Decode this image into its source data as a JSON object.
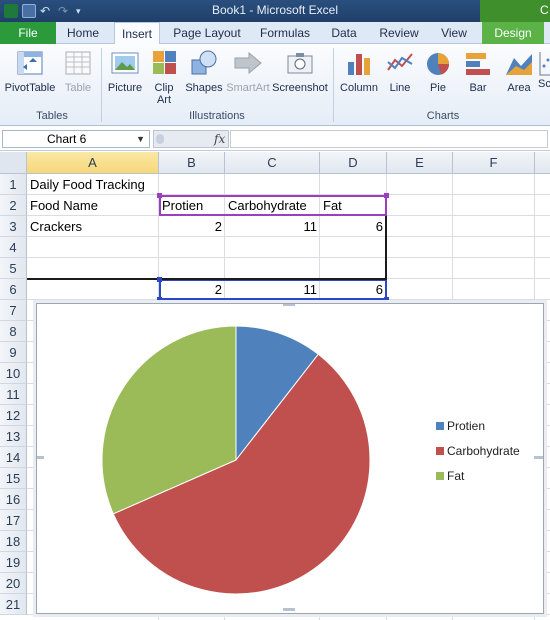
{
  "window": {
    "title": "Book1 - Microsoft Excel",
    "context_tab_group": "C"
  },
  "tabs": [
    {
      "label": "File"
    },
    {
      "label": "Home"
    },
    {
      "label": "Insert"
    },
    {
      "label": "Page Layout"
    },
    {
      "label": "Formulas"
    },
    {
      "label": "Data"
    },
    {
      "label": "Review"
    },
    {
      "label": "View"
    },
    {
      "label": "Design"
    }
  ],
  "ribbon": {
    "tables": {
      "group": "Tables",
      "pivot": "PivotTable",
      "table": "Table"
    },
    "illustrations": {
      "group": "Illustrations",
      "picture": "Picture",
      "clip_line1": "Clip",
      "clip_line2": "Art",
      "shapes": "Shapes",
      "smartart": "SmartArt",
      "screenshot": "Screenshot"
    },
    "charts": {
      "group": "Charts",
      "column": "Column",
      "line": "Line",
      "pie": "Pie",
      "bar": "Bar",
      "area": "Area",
      "scatter": "Sc"
    }
  },
  "formula_bar": {
    "name_box": "Chart 6",
    "fx": "fx"
  },
  "grid": {
    "columns": [
      "A",
      "B",
      "C",
      "D",
      "E",
      "F",
      "G"
    ],
    "rows": [
      "1",
      "2",
      "3",
      "4",
      "5",
      "6",
      "7",
      "8",
      "9",
      "10",
      "11",
      "12",
      "13",
      "14",
      "15",
      "16",
      "17",
      "18",
      "19",
      "20",
      "21"
    ],
    "cells": {
      "A1": "Daily Food Tracking",
      "A2": "Food Name",
      "B2": "Protien",
      "C2": "Carbohydrate",
      "D2": "Fat",
      "A3": "Crackers",
      "B3": "2",
      "C3": "11",
      "D3": "6",
      "B6": "2",
      "C6": "11",
      "D6": "6"
    }
  },
  "chart_data": {
    "type": "pie",
    "categories": [
      "Protien",
      "Carbohydrate",
      "Fat"
    ],
    "values": [
      2,
      11,
      6
    ],
    "colors": [
      "#4f81bd",
      "#c0504d",
      "#9bbb59"
    ],
    "legend_position": "right",
    "title": ""
  }
}
